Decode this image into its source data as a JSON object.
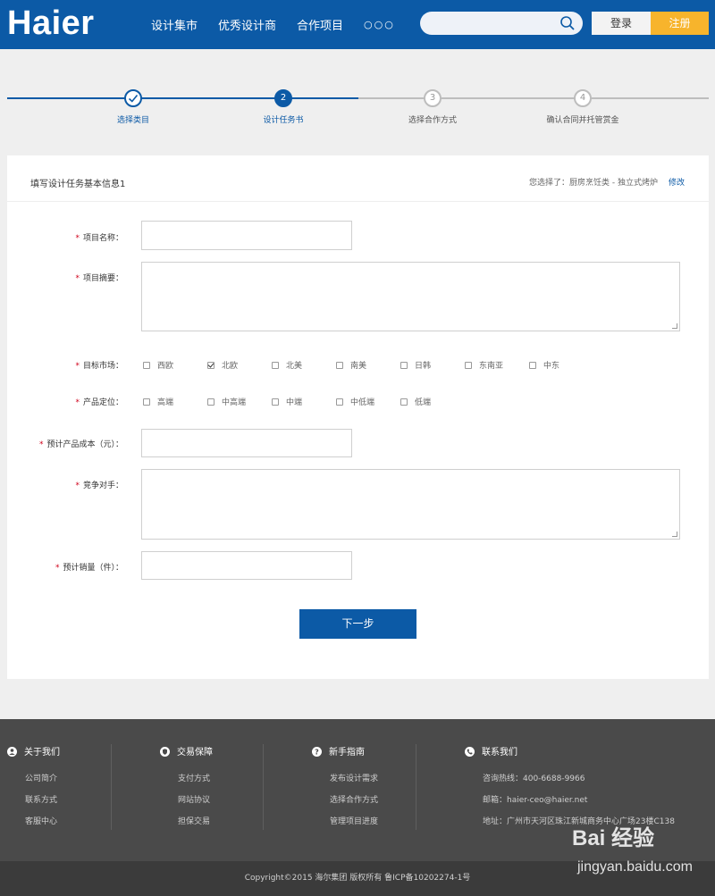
{
  "header": {
    "logo": "Haier",
    "nav": [
      "设计集市",
      "优秀设计商",
      "合作项目"
    ],
    "more": "○○○",
    "search_placeholder": "",
    "login": "登录",
    "register": "注册"
  },
  "steps": [
    {
      "num": "✓",
      "label": "选择类目",
      "state": "done"
    },
    {
      "num": "2",
      "label": "设计任务书",
      "state": "active"
    },
    {
      "num": "3",
      "label": "选择合作方式",
      "state": "todo"
    },
    {
      "num": "4",
      "label": "确认合同并托管赏金",
      "state": "todo"
    }
  ],
  "form": {
    "title": "填写设计任务基本信息1",
    "selected": "您选择了：厨房烹饪类 - 独立式烤炉",
    "edit": "修改",
    "required_mark": "*",
    "fields": {
      "project_name": "项目名称：",
      "project_summary": "项目摘要：",
      "target_market": "目标市场：",
      "product_position": "产品定位：",
      "est_cost": "预计产品成本（元）：",
      "competitors": "竞争对手：",
      "est_sales": "预计销量（件）："
    },
    "markets": [
      {
        "label": "西欧",
        "checked": false
      },
      {
        "label": "北欧",
        "checked": true
      },
      {
        "label": "北美",
        "checked": false
      },
      {
        "label": "南美",
        "checked": false
      },
      {
        "label": "日韩",
        "checked": false
      },
      {
        "label": "东南亚",
        "checked": false
      },
      {
        "label": "中东",
        "checked": false
      }
    ],
    "positions": [
      {
        "label": "高端",
        "checked": false
      },
      {
        "label": "中高端",
        "checked": false
      },
      {
        "label": "中端",
        "checked": false
      },
      {
        "label": "中低端",
        "checked": false
      },
      {
        "label": "低端",
        "checked": false
      }
    ],
    "next": "下一步"
  },
  "footer": {
    "columns": [
      {
        "title": "关于我们",
        "icon": "user-icon",
        "links": [
          "公司简介",
          "联系方式",
          "客服中心"
        ]
      },
      {
        "title": "交易保障",
        "icon": "shield-icon",
        "links": [
          "支付方式",
          "网站协议",
          "担保交易"
        ]
      },
      {
        "title": "新手指南",
        "icon": "question-icon",
        "links": [
          "发布设计需求",
          "选择合作方式",
          "管理项目进度"
        ]
      },
      {
        "title": "联系我们",
        "icon": "phone-icon",
        "links": [
          "咨询热线：400-6688-9966",
          "邮箱：haier-ceo@haier.net",
          "地址：广州市天河区珠江新城商务中心广场23楼C138"
        ]
      }
    ],
    "copyright": "Copyright©2015 海尔集团 版权所有 鲁ICP备10202274-1号"
  },
  "watermark": {
    "top": "Bai 经验",
    "bottom": "jingyan.baidu.com"
  }
}
